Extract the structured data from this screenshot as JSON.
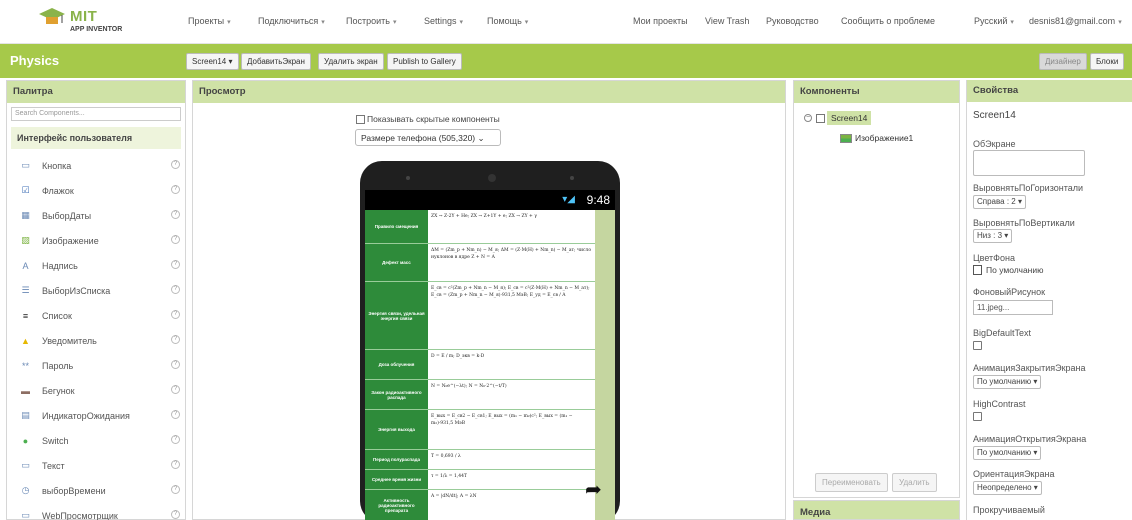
{
  "header": {
    "logo_mit": "MIT",
    "logo_sub": "APP INVENTOR",
    "menu": [
      "Проекты",
      "Подключиться",
      "Построить",
      "Settings",
      "Помощь"
    ],
    "links": [
      "Мои проекты",
      "View Trash",
      "Руководство",
      "Сообщить о проблеме"
    ],
    "language": "Русский",
    "account": "desnis81@gmail.com"
  },
  "toolbar": {
    "project_name": "Physics",
    "screen_select": "Screen14",
    "add_screen": "ДобавитьЭкран",
    "remove_screen": "Удалить экран",
    "publish": "Publish to Gallery",
    "designer": "Дизайнер",
    "blocks": "Блоки"
  },
  "palette": {
    "title": "Палитра",
    "search_placeholder": "Search Components...",
    "category": "Интерфейс пользователя",
    "items": [
      {
        "label": "Кнопка",
        "icon": "button-icon"
      },
      {
        "label": "Флажок",
        "icon": "checkbox-icon"
      },
      {
        "label": "ВыборДаты",
        "icon": "datepicker-icon"
      },
      {
        "label": "Изображение",
        "icon": "image-icon"
      },
      {
        "label": "Надпись",
        "icon": "label-icon"
      },
      {
        "label": "ВыборИзСписка",
        "icon": "listpicker-icon"
      },
      {
        "label": "Список",
        "icon": "listview-icon"
      },
      {
        "label": "Уведомитель",
        "icon": "notifier-icon"
      },
      {
        "label": "Пароль",
        "icon": "password-icon"
      },
      {
        "label": "Бегунок",
        "icon": "slider-icon"
      },
      {
        "label": "ИндикаторОжидания",
        "icon": "spinner-icon"
      },
      {
        "label": "Switch",
        "icon": "switch-icon"
      },
      {
        "label": "Текст",
        "icon": "textbox-icon"
      },
      {
        "label": "выборВремени",
        "icon": "timepicker-icon"
      },
      {
        "label": "WebПросмотрщик",
        "icon": "webviewer-icon"
      }
    ]
  },
  "viewer": {
    "title": "Просмотр",
    "show_hidden": "Показывать скрытые компоненты",
    "size_select": "Размере телефона (505,320)",
    "status_time": "9:48",
    "table_rows": [
      {
        "label": "Правило смещения",
        "formula": "ZX → Z-2Y + He; ZX → Z+1Y + e; ZX → ZY + γ"
      },
      {
        "label": "Дефект масс",
        "formula": "ΔM = (Zm_p + Nm_n) − M_я; ΔM = (Z·M(H) + Nm_n) − M_ат; число нуклонов в ядре Z + N = A"
      },
      {
        "label": "Энергия связи, удельная энергия связи",
        "formula": "E_св = c²(Zm_p + Nm_n − M_я); E_св = c²(Z·M(H) + Nm_n − M_ат); E_св = (Zm_p + Nm_n − M_я)·931,5 МэВ; E_уд = E_св / A"
      },
      {
        "label": "Доза облучения",
        "formula": "D = E / m; D_экв = k·D"
      },
      {
        "label": "Закон радиоактивного распада",
        "formula": "N = N₀e^(−λt); N = N₀·2^(−t/T)"
      },
      {
        "label": "Энергия выхода",
        "formula": "E_вых = E_св2 − E_св1; E_вых = (m₁ − m₂)c²; E_вых = (m₁ − m₂)·931,5 МэВ"
      },
      {
        "label": "Период полураспада",
        "formula": "T = 0,693 / λ"
      },
      {
        "label": "Среднее время жизни",
        "formula": "τ = 1/λ = 1,44T"
      },
      {
        "label": "Активность радиоактивного препарата",
        "formula": "A = |dN/dt|; A = λN"
      }
    ]
  },
  "components": {
    "title": "Компоненты",
    "root": "Screen14",
    "child": "Изображение1",
    "rename": "Переименовать",
    "delete": "Удалить",
    "media": "Медиа"
  },
  "properties": {
    "title": "Свойства",
    "screen_name": "Screen14",
    "about_label": "ОбЭкране",
    "halign_label": "ВыровнятьПоГоризонтали",
    "halign_value": "Справа : 2",
    "valign_label": "ВыровнятьПоВертикали",
    "valign_value": "Низ : 3",
    "bgcolor_label": "ЦветФона",
    "bgcolor_value": "По умолчанию",
    "bgimage_label": "ФоновыйРисунок",
    "bgimage_value": "11.jpeg...",
    "bigtext_label": "BigDefaultText",
    "closeanim_label": "АнимацияЗакрытияЭкрана",
    "closeanim_value": "По умолчанию",
    "contrast_label": "HighContrast",
    "openanim_label": "АнимацияОткрытияЭкрана",
    "openanim_value": "По умолчанию",
    "orientation_label": "ОриентацияЭкрана",
    "orientation_value": "Неопределено",
    "scrollable_label": "Прокручиваемый"
  }
}
